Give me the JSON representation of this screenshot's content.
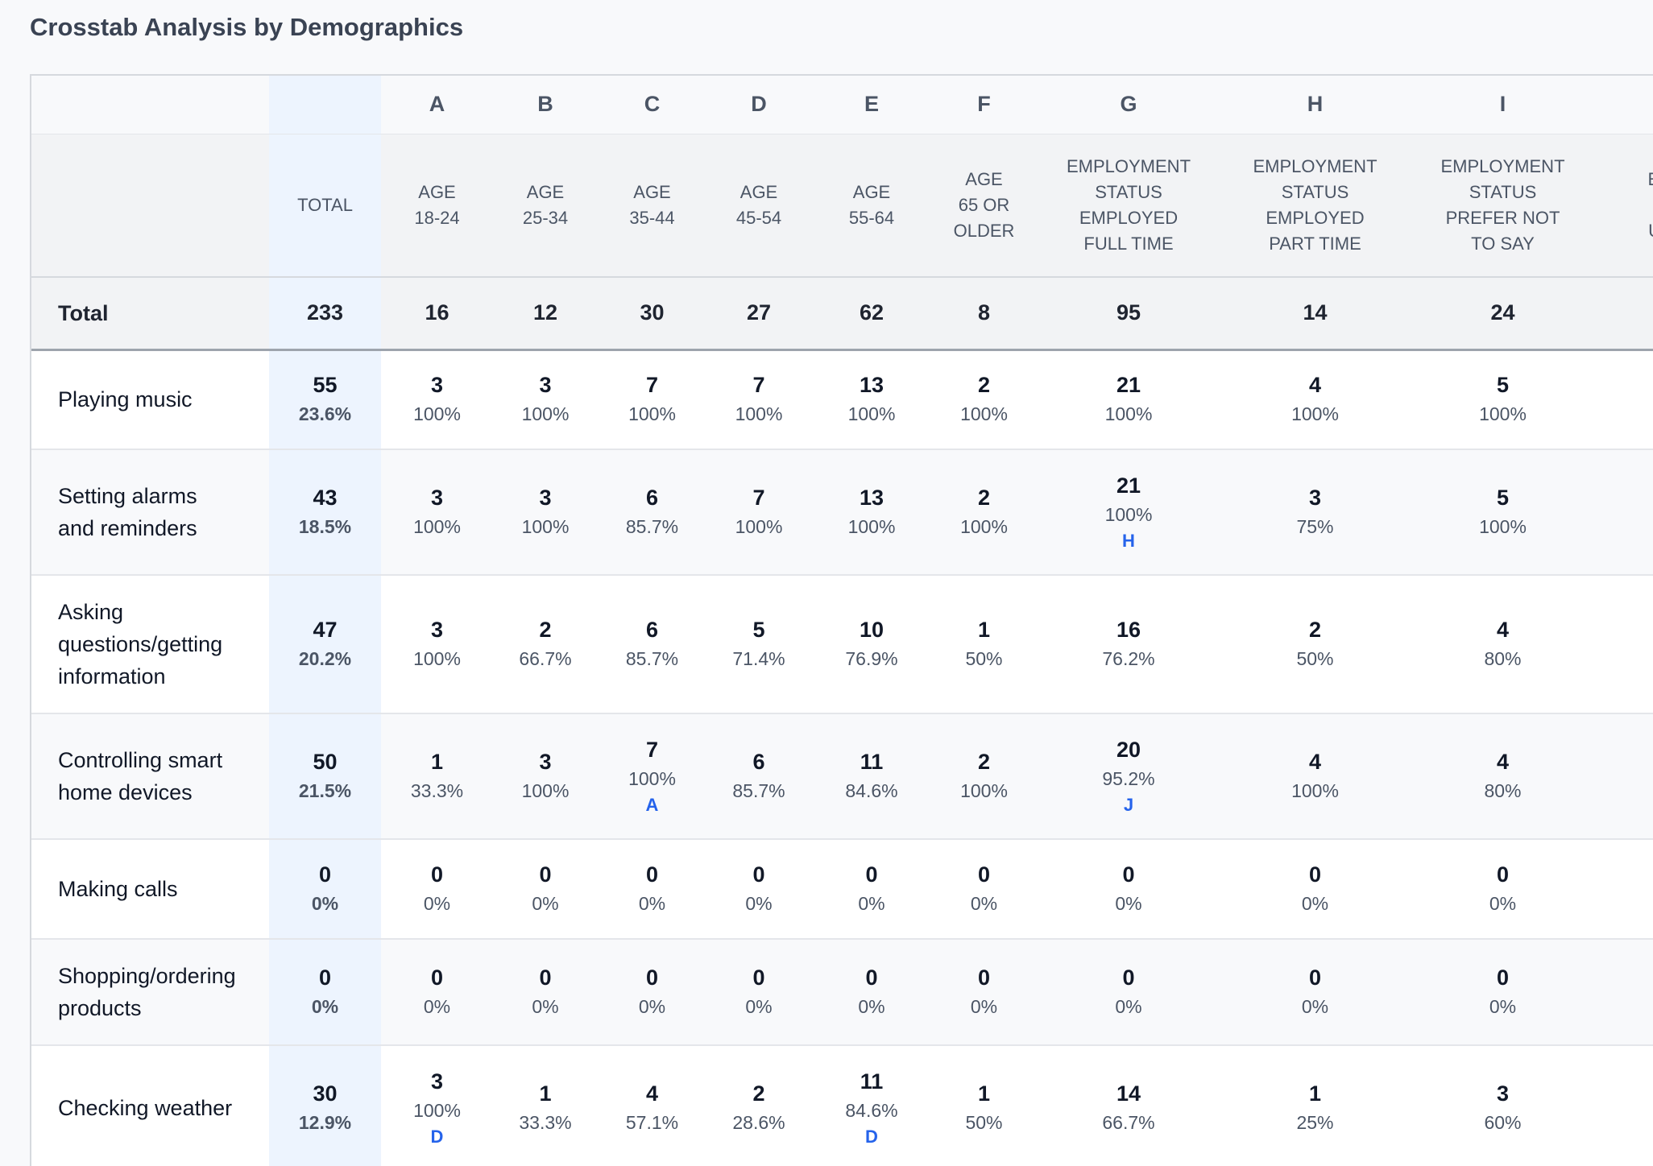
{
  "page": {
    "title": "Crosstab Analysis by Demographics"
  },
  "columns": [
    {
      "letter": "",
      "header": [
        "TOTAL"
      ]
    },
    {
      "letter": "A",
      "header": [
        "AGE",
        "18-24"
      ]
    },
    {
      "letter": "B",
      "header": [
        "AGE",
        "25-34"
      ]
    },
    {
      "letter": "C",
      "header": [
        "AGE",
        "35-44"
      ]
    },
    {
      "letter": "D",
      "header": [
        "AGE",
        "45-54"
      ]
    },
    {
      "letter": "E",
      "header": [
        "AGE",
        "55-64"
      ]
    },
    {
      "letter": "F",
      "header": [
        "AGE",
        "65 OR",
        "OLDER"
      ]
    },
    {
      "letter": "G",
      "header": [
        "EMPLOYMENT",
        "STATUS",
        "EMPLOYED",
        "FULL TIME"
      ]
    },
    {
      "letter": "H",
      "header": [
        "EMPLOYMENT",
        "STATUS",
        "EMPLOYED",
        "PART TIME"
      ]
    },
    {
      "letter": "I",
      "header": [
        "EMPLOYMENT",
        "STATUS",
        "PREFER NOT",
        "TO SAY"
      ]
    },
    {
      "letter": "",
      "header": [
        "EM",
        "",
        "UN"
      ]
    }
  ],
  "total_row": {
    "label": "Total",
    "values": [
      "233",
      "16",
      "12",
      "30",
      "27",
      "62",
      "8",
      "95",
      "14",
      "24"
    ]
  },
  "rows": [
    {
      "label": [
        "Playing music"
      ],
      "cells": [
        [
          "55",
          "23.6%",
          ""
        ],
        [
          "3",
          "100%",
          ""
        ],
        [
          "3",
          "100%",
          ""
        ],
        [
          "7",
          "100%",
          ""
        ],
        [
          "7",
          "100%",
          ""
        ],
        [
          "13",
          "100%",
          ""
        ],
        [
          "2",
          "100%",
          ""
        ],
        [
          "21",
          "100%",
          ""
        ],
        [
          "4",
          "100%",
          ""
        ],
        [
          "5",
          "100%",
          ""
        ]
      ]
    },
    {
      "label": [
        "Setting alarms",
        "and reminders"
      ],
      "cells": [
        [
          "43",
          "18.5%",
          ""
        ],
        [
          "3",
          "100%",
          ""
        ],
        [
          "3",
          "100%",
          ""
        ],
        [
          "6",
          "85.7%",
          ""
        ],
        [
          "7",
          "100%",
          ""
        ],
        [
          "13",
          "100%",
          ""
        ],
        [
          "2",
          "100%",
          ""
        ],
        [
          "21",
          "100%",
          "H"
        ],
        [
          "3",
          "75%",
          ""
        ],
        [
          "5",
          "100%",
          ""
        ]
      ]
    },
    {
      "label": [
        "Asking",
        "questions/getting",
        "information"
      ],
      "cells": [
        [
          "47",
          "20.2%",
          ""
        ],
        [
          "3",
          "100%",
          ""
        ],
        [
          "2",
          "66.7%",
          ""
        ],
        [
          "6",
          "85.7%",
          ""
        ],
        [
          "5",
          "71.4%",
          ""
        ],
        [
          "10",
          "76.9%",
          ""
        ],
        [
          "1",
          "50%",
          ""
        ],
        [
          "16",
          "76.2%",
          ""
        ],
        [
          "2",
          "50%",
          ""
        ],
        [
          "4",
          "80%",
          ""
        ]
      ]
    },
    {
      "label": [
        "Controlling smart",
        "home devices"
      ],
      "cells": [
        [
          "50",
          "21.5%",
          ""
        ],
        [
          "1",
          "33.3%",
          ""
        ],
        [
          "3",
          "100%",
          ""
        ],
        [
          "7",
          "100%",
          "A"
        ],
        [
          "6",
          "85.7%",
          ""
        ],
        [
          "11",
          "84.6%",
          ""
        ],
        [
          "2",
          "100%",
          ""
        ],
        [
          "20",
          "95.2%",
          "J"
        ],
        [
          "4",
          "100%",
          ""
        ],
        [
          "4",
          "80%",
          ""
        ]
      ]
    },
    {
      "label": [
        "Making calls"
      ],
      "cells": [
        [
          "0",
          "0%",
          ""
        ],
        [
          "0",
          "0%",
          ""
        ],
        [
          "0",
          "0%",
          ""
        ],
        [
          "0",
          "0%",
          ""
        ],
        [
          "0",
          "0%",
          ""
        ],
        [
          "0",
          "0%",
          ""
        ],
        [
          "0",
          "0%",
          ""
        ],
        [
          "0",
          "0%",
          ""
        ],
        [
          "0",
          "0%",
          ""
        ],
        [
          "0",
          "0%",
          ""
        ]
      ]
    },
    {
      "label": [
        "Shopping/ordering",
        "products"
      ],
      "cells": [
        [
          "0",
          "0%",
          ""
        ],
        [
          "0",
          "0%",
          ""
        ],
        [
          "0",
          "0%",
          ""
        ],
        [
          "0",
          "0%",
          ""
        ],
        [
          "0",
          "0%",
          ""
        ],
        [
          "0",
          "0%",
          ""
        ],
        [
          "0",
          "0%",
          ""
        ],
        [
          "0",
          "0%",
          ""
        ],
        [
          "0",
          "0%",
          ""
        ],
        [
          "0",
          "0%",
          ""
        ]
      ]
    },
    {
      "label": [
        "Checking weather"
      ],
      "cells": [
        [
          "30",
          "12.9%",
          ""
        ],
        [
          "3",
          "100%",
          "D"
        ],
        [
          "1",
          "33.3%",
          ""
        ],
        [
          "4",
          "57.1%",
          ""
        ],
        [
          "2",
          "28.6%",
          ""
        ],
        [
          "11",
          "84.6%",
          "D"
        ],
        [
          "1",
          "50%",
          ""
        ],
        [
          "14",
          "66.7%",
          ""
        ],
        [
          "1",
          "25%",
          ""
        ],
        [
          "3",
          "60%",
          ""
        ]
      ]
    }
  ]
}
